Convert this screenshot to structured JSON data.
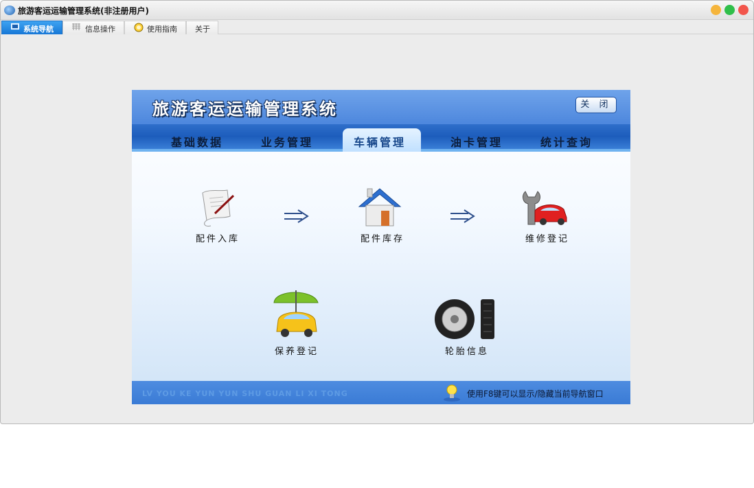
{
  "window": {
    "title": "旅游客运运输管理系统(非注册用户)",
    "controls": [
      "minimize",
      "maximize",
      "close"
    ]
  },
  "tabs": [
    {
      "label": "系统导航",
      "icon": "monitor-icon",
      "active": true
    },
    {
      "label": "信息操作",
      "icon": "grid-icon",
      "active": false
    },
    {
      "label": "使用指南",
      "icon": "clock-icon",
      "active": false
    },
    {
      "label": "关于",
      "icon": "",
      "active": false
    }
  ],
  "nav": {
    "title": "旅游客运运输管理系统",
    "close_label": "关 闭",
    "menu": [
      {
        "label": "基础数据",
        "active": false
      },
      {
        "label": "业务管理",
        "active": false
      },
      {
        "label": "车辆管理",
        "active": true
      },
      {
        "label": "油卡管理",
        "active": false
      },
      {
        "label": "统计查询",
        "active": false
      }
    ],
    "items": [
      {
        "label": "配件入库",
        "icon": "document-pen-icon"
      },
      {
        "label": "配件库存",
        "icon": "house-icon"
      },
      {
        "label": "维修登记",
        "icon": "wrench-car-icon"
      },
      {
        "label": "保养登记",
        "icon": "umbrella-car-icon"
      },
      {
        "label": "轮胎信息",
        "icon": "tire-icon"
      }
    ],
    "footer": {
      "left_text": "LV YOU KE YUN YUN SHU GUAN LI XI TONG",
      "hint": "使用F8键可以显示/隐藏当前导航窗口"
    }
  },
  "colors": {
    "header_blue": "#4d87dd",
    "menu_blue": "#1d5dbc",
    "active_tab": "#1777d6"
  }
}
